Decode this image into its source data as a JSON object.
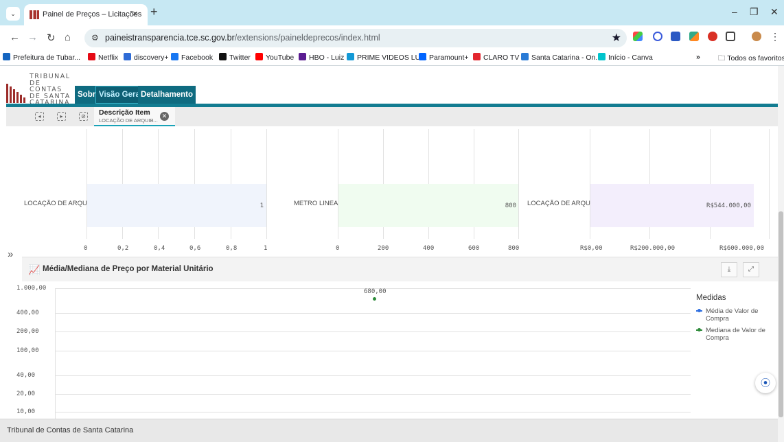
{
  "browser": {
    "tab_title": "Painel de Preços – Licitações",
    "tab_close_icon": "×",
    "new_tab_icon": "+",
    "url_host": "paineistransparencia.tce.sc.gov.br",
    "url_path": "/extensions/paineldeprecos/index.html"
  },
  "bookmarks": [
    {
      "label": "Prefeitura de Tubar...",
      "color": "#1565c0"
    },
    {
      "label": "Netflix",
      "color": "#e50914"
    },
    {
      "label": "discovery+",
      "color": "#2e6bd6"
    },
    {
      "label": "Facebook",
      "color": "#1877f2"
    },
    {
      "label": "Twitter",
      "color": "#111111"
    },
    {
      "label": "YouTube",
      "color": "#ff0000"
    },
    {
      "label": "HBO - Luiz",
      "color": "#5a1c91"
    },
    {
      "label": "PRIME VIDEOS LUIZ",
      "color": "#1399d6"
    },
    {
      "label": "Paramount+",
      "color": "#0064ff"
    },
    {
      "label": "CLARO TV",
      "color": "#e3262e"
    },
    {
      "label": "Santa Catarina - On...",
      "color": "#2a7bd6"
    },
    {
      "label": "Início - Canva",
      "color": "#00c4cc"
    }
  ],
  "bookmarks_overflow": "»",
  "bookmarks_all": "Todos os favoritos",
  "site": {
    "logo_lines": [
      "TRIBUNAL",
      "DE CONTAS",
      "DE SANTA",
      "CATARINA"
    ],
    "tabs": [
      "Sobre",
      "Visão Geral",
      "Detalhamento"
    ],
    "active_tab": "Visão Geral"
  },
  "filter": {
    "label": "Descrição Item",
    "value": "LOCAÇÃO DE ARQUIB..."
  },
  "bar_charts": [
    {
      "category": "LOCAÇÃO DE ARQUI...",
      "value_label": "1",
      "ticks": [
        "0",
        "0,2",
        "0,4",
        "0,6",
        "0,8",
        "1"
      ],
      "color": "#f0f4fc"
    },
    {
      "category": "METRO LINEAR",
      "value_label": "800",
      "ticks": [
        "0",
        "200",
        "400",
        "600",
        "800"
      ],
      "color": "#f0fcf0"
    },
    {
      "category": "LOCAÇÃO DE ARQUI...",
      "value_label": "R$544.000,00",
      "ticks": [
        "R$0,00",
        "R$200.000,00",
        "R$600.000,00"
      ],
      "color": "#f3eefc"
    }
  ],
  "panel": {
    "title": "Média/Mediana de Preço por Material Unitário",
    "download_icon": "⤓",
    "expand_icon": "⤢"
  },
  "line_chart": {
    "y_ticks": [
      "1.000,00",
      "400,00",
      "200,00",
      "100,00",
      "40,00",
      "20,00",
      "10,00"
    ],
    "point_label": "680,00",
    "legend_title": "Medidas",
    "series": [
      {
        "name": "Média de Valor de Compra",
        "color": "#2f6fe0"
      },
      {
        "name": "Mediana de Valor de Compra",
        "color": "#2e8b3a"
      }
    ]
  },
  "footer": "Tribunal de Contas de Santa Catarina",
  "collapse_icon": "»"
}
